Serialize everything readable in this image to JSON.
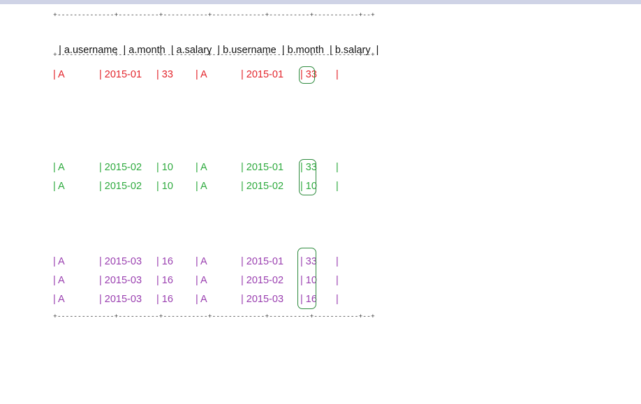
{
  "separator": "+--------------+----------+-----------+-------------+----------+-----------+--+",
  "header": "| a.username  | a.month  | a.salary  | b.username  | b.month  | b.salary  |",
  "groups": [
    {
      "color": "#e3242b",
      "rows": [
        [
          "| A",
          "| 2015-01",
          "| 33",
          "| A",
          "| 2015-01",
          "| 33",
          "|"
        ]
      ]
    },
    {
      "color": "#2eaa3e",
      "rows": [
        [
          "| A",
          "| 2015-02",
          "| 10",
          "| A",
          "| 2015-01",
          "| 33",
          "|"
        ],
        [
          "| A",
          "| 2015-02",
          "| 10",
          "| A",
          "| 2015-02",
          "| 10",
          "|"
        ]
      ]
    },
    {
      "color": "#9a3fb0",
      "rows": [
        [
          "| A",
          "| 2015-03",
          "| 16",
          "| A",
          "| 2015-01",
          "| 33",
          "|"
        ],
        [
          "| A",
          "| 2015-03",
          "| 16",
          "| A",
          "| 2015-02",
          "| 10",
          "|"
        ],
        [
          "| A",
          "| 2015-03",
          "| 16",
          "| A",
          "| 2015-03",
          "| 16",
          "|"
        ]
      ]
    }
  ],
  "highlight_box_color": "#2e8b3e"
}
